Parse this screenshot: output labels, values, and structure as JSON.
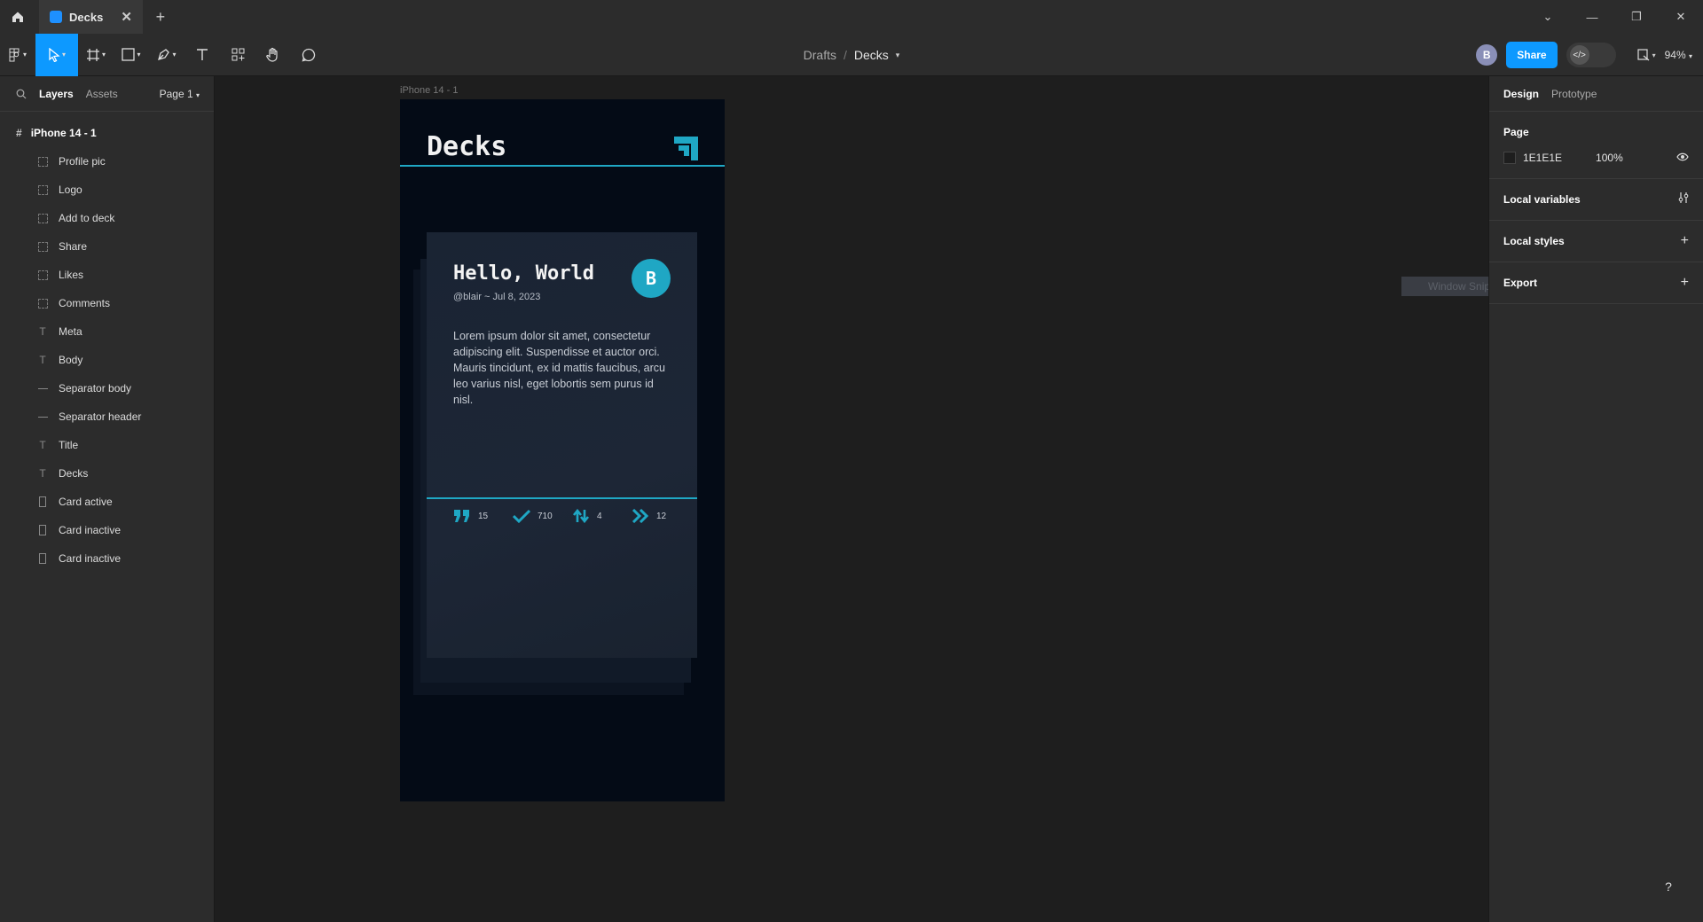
{
  "titlebar": {
    "tab_title": "Decks",
    "new_tab": "+",
    "close_tab": "✕"
  },
  "toolbar": {
    "breadcrumb_parent": "Drafts",
    "breadcrumb_current": "Decks",
    "user_initial": "B",
    "share_label": "Share",
    "zoom": "94%"
  },
  "left_panel": {
    "tabs": {
      "layers": "Layers",
      "assets": "Assets",
      "page": "Page 1"
    },
    "frame_name": "iPhone 14 - 1",
    "layers": [
      {
        "name": "Profile pic",
        "icon": "dashed-frame-icon"
      },
      {
        "name": "Logo",
        "icon": "dashed-frame-icon"
      },
      {
        "name": "Add to deck",
        "icon": "dashed-frame-icon"
      },
      {
        "name": "Share",
        "icon": "dashed-frame-icon"
      },
      {
        "name": "Likes",
        "icon": "dashed-frame-icon"
      },
      {
        "name": "Comments",
        "icon": "dashed-frame-icon"
      },
      {
        "name": "Meta",
        "icon": "text-icon"
      },
      {
        "name": "Body",
        "icon": "text-icon"
      },
      {
        "name": "Separator body",
        "icon": "line-icon"
      },
      {
        "name": "Separator header",
        "icon": "line-icon"
      },
      {
        "name": "Title",
        "icon": "text-icon"
      },
      {
        "name": "Decks",
        "icon": "text-icon"
      },
      {
        "name": "Card active",
        "icon": "rectangle-icon"
      },
      {
        "name": "Card inactive",
        "icon": "rectangle-icon"
      },
      {
        "name": "Card inactive",
        "icon": "rectangle-icon"
      }
    ]
  },
  "canvas": {
    "frame_label": "iPhone 14 - 1",
    "app_title": "Decks",
    "card": {
      "title": "Hello, World",
      "meta": "@blair ~ Jul 8, 2023",
      "avatar_initial": "B",
      "body": "Lorem ipsum dolor sit amet, consectetur adipiscing elit. Suspendisse et auctor orci. Mauris tincidunt, ex id mattis faucibus, arcu leo varius nisl, eget lobortis sem purus id nisl.",
      "stats": [
        {
          "icon": "quote-icon",
          "value": "15"
        },
        {
          "icon": "check-icon",
          "value": "710"
        },
        {
          "icon": "swap-arrows-icon",
          "value": "4"
        },
        {
          "icon": "double-chevron-right-icon",
          "value": "12"
        }
      ]
    },
    "snip_label": "Window Snip"
  },
  "right_panel": {
    "tabs": {
      "design": "Design",
      "prototype": "Prototype"
    },
    "page_heading": "Page",
    "page_color": "1E1E1E",
    "page_opacity": "100%",
    "local_variables": "Local variables",
    "local_styles": "Local styles",
    "export": "Export"
  },
  "colors": {
    "accent": "#0d99ff",
    "teal": "#1fa7c4",
    "phone_bg": "#040b16"
  }
}
